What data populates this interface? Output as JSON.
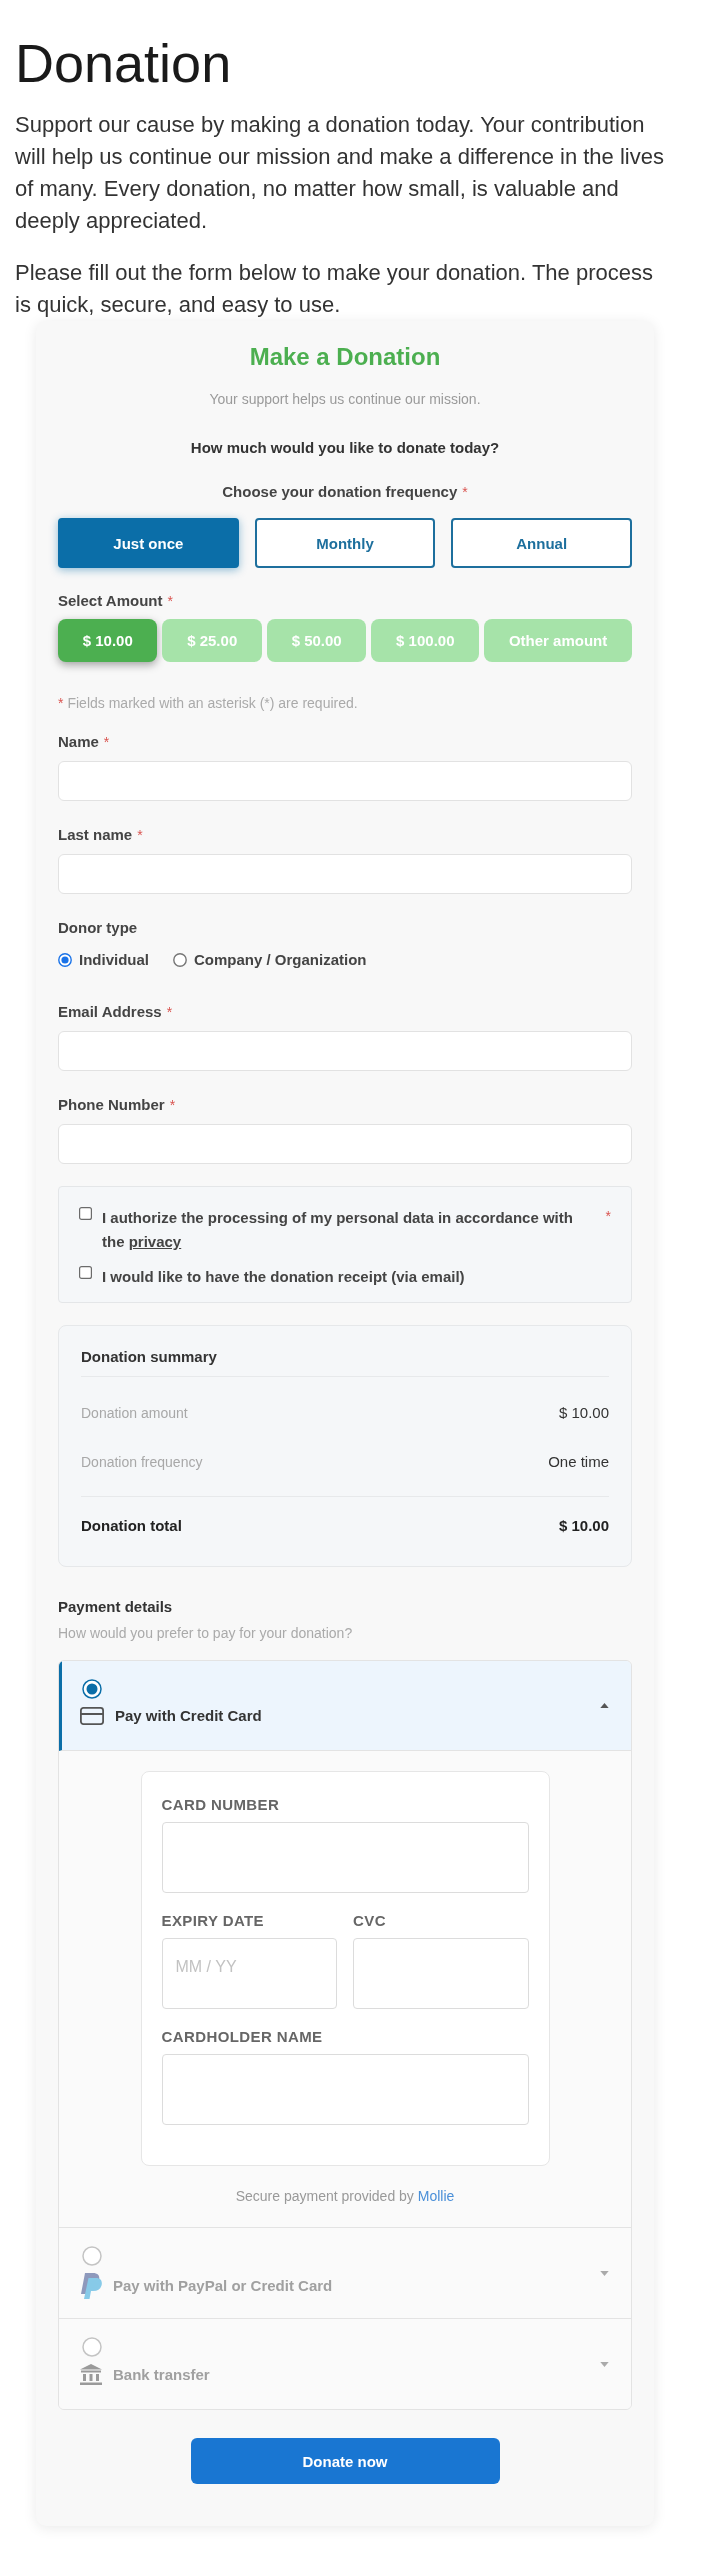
{
  "page": {
    "title": "Donation",
    "paragraphs": [
      "Support our cause by making a donation today. Your contribution will help us continue our mission and make a difference in the lives of many. Every donation, no matter how small, is valuable and deeply appreciated.",
      "Please fill out the form below to make your donation. The process is quick, secure, and easy to use."
    ]
  },
  "form": {
    "title": "Make a Donation",
    "subtitle": "Your support helps us continue our mission.",
    "question": "How much would you like to donate today?",
    "frequency": {
      "label": "Choose your donation frequency",
      "required_mark": "*",
      "options": [
        {
          "label": "Just once",
          "selected": true
        },
        {
          "label": "Monthly",
          "selected": false
        },
        {
          "label": "Annual",
          "selected": false
        }
      ]
    },
    "amount": {
      "label": "Select Amount",
      "required_mark": "*",
      "options": [
        {
          "label": "$ 10.00",
          "selected": true
        },
        {
          "label": "$ 25.00",
          "selected": false
        },
        {
          "label": "$ 50.00",
          "selected": false
        },
        {
          "label": "$ 100.00",
          "selected": false
        },
        {
          "label": "Other amount",
          "selected": false
        }
      ]
    },
    "required_note": {
      "mark": "*",
      "text": "Fields marked with an asterisk (*) are required."
    },
    "fields": [
      {
        "kind": "input",
        "label": "Name",
        "required_mark": "*"
      },
      {
        "kind": "input",
        "label": "Last name",
        "required_mark": "*"
      },
      {
        "kind": "radio",
        "label": "Donor type",
        "options": [
          {
            "label": "Individual",
            "selected": true
          },
          {
            "label": "Company / Organization",
            "selected": false
          }
        ]
      },
      {
        "kind": "input",
        "label": "Email Address",
        "required_mark": "*"
      },
      {
        "kind": "input",
        "label": "Phone Number",
        "required_mark": "*"
      }
    ],
    "consents": [
      {
        "text": "I authorize the processing of my personal data in accordance with the",
        "link": "privacy",
        "required_mark": "*",
        "checked": false
      },
      {
        "text": "I would like to have the donation receipt (via email)",
        "checked": false
      }
    ],
    "summary": {
      "title": "Donation summary",
      "rows": [
        {
          "label": "Donation amount",
          "value": "$ 10.00"
        },
        {
          "label": "Donation frequency",
          "value": "One time"
        }
      ],
      "total": {
        "label": "Donation total",
        "value": "$ 10.00"
      }
    },
    "payment": {
      "title": "Payment details",
      "subtitle": "How would you prefer to pay for your donation?",
      "methods": [
        {
          "kind": "card",
          "label": "Pay with Credit Card",
          "selected": true,
          "expanded": true,
          "details": {
            "rows": [
              [
                {
                  "label": "CARD NUMBER"
                }
              ],
              [
                {
                  "label": "EXPIRY DATE",
                  "placeholder": "MM / YY"
                },
                {
                  "label": "CVC"
                }
              ],
              [
                {
                  "label": "CARDHOLDER NAME"
                }
              ]
            ],
            "note": "Secure payment provided by",
            "provider": "Mollie"
          }
        },
        {
          "kind": "paypal",
          "label": "Pay with PayPal or Credit Card",
          "selected": false,
          "expanded": false
        },
        {
          "kind": "bank",
          "label": "Bank transfer",
          "selected": false,
          "expanded": false
        }
      ]
    },
    "submit": "Donate now"
  }
}
